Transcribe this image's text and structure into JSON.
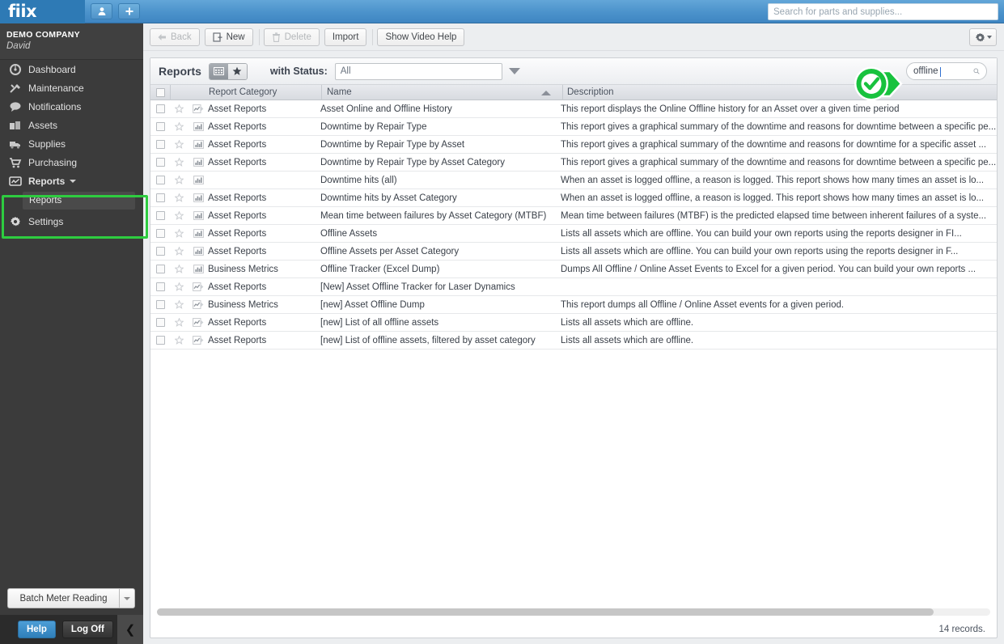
{
  "header": {
    "logo_text": "fiix",
    "buttons": [
      {
        "name": "user-button",
        "icon": "person-icon"
      },
      {
        "name": "add-button",
        "icon": "plus-icon"
      }
    ],
    "search_placeholder": "Search for parts and supplies...",
    "search_value": ""
  },
  "sidebar": {
    "company": "DEMO COMPANY",
    "user": "David",
    "items": [
      {
        "label": "Dashboard",
        "icon": "gauge-icon"
      },
      {
        "label": "Maintenance",
        "icon": "tools-icon"
      },
      {
        "label": "Notifications",
        "icon": "speech-bubble-icon"
      },
      {
        "label": "Assets",
        "icon": "boxes-icon"
      },
      {
        "label": "Supplies",
        "icon": "truck-icon"
      },
      {
        "label": "Purchasing",
        "icon": "cart-icon"
      },
      {
        "label": "Reports",
        "icon": "chart-icon",
        "expanded": true
      },
      {
        "label": "Settings",
        "icon": "gear-icon"
      }
    ],
    "sub_item": "Reports",
    "batch_button": "Batch Meter Reading",
    "help_button": "Help",
    "logoff_button": "Log Off",
    "highlight_color": "#2ecc40"
  },
  "toolbar": {
    "back": "Back",
    "new": "New",
    "delete": "Delete",
    "import": "Import",
    "video_help": "Show Video Help",
    "gear": "gear-icon"
  },
  "panel": {
    "title": "Reports",
    "status_label": "with Status:",
    "status_value": "All",
    "search_value": "offline",
    "records": "14 records."
  },
  "table": {
    "columns": [
      "Report Category",
      "Name",
      "Description"
    ],
    "sort_column": "Name",
    "sort_direction": "asc",
    "rows": [
      {
        "category": "Asset Reports",
        "name": "Asset Online and Offline History",
        "description": "This report displays the Online Offline history for an Asset over a given time period",
        "type_icon": "line-chart-icon"
      },
      {
        "category": "Asset Reports",
        "name": "Downtime by Repair Type",
        "description": "This report gives a graphical summary of the downtime and reasons for downtime between a specific pe...",
        "type_icon": "bar-chart-icon"
      },
      {
        "category": "Asset Reports",
        "name": "Downtime by Repair Type by Asset",
        "description": "This report gives a graphical summary of the downtime and reasons for downtime for a specific asset ...",
        "type_icon": "bar-chart-icon"
      },
      {
        "category": "Asset Reports",
        "name": "Downtime by Repair Type by Asset Category",
        "description": "This report gives a graphical summary of the downtime and reasons for downtime between a specific pe...",
        "type_icon": "bar-chart-icon"
      },
      {
        "category": "",
        "name": "Downtime hits (all)",
        "description": "When an asset is logged offline, a reason is logged. This report shows how many times an asset is lo...",
        "type_icon": "bar-chart-icon"
      },
      {
        "category": "Asset Reports",
        "name": "Downtime hits by Asset Category",
        "description": "When an asset is logged offline, a reason is logged. This report shows how many times an asset is lo...",
        "type_icon": "bar-chart-icon"
      },
      {
        "category": "Asset Reports",
        "name": "Mean time between failures by Asset Category (MTBF)",
        "description": "Mean time between failures (MTBF) is the predicted elapsed time between inherent failures of a syste...",
        "type_icon": "bar-chart-icon"
      },
      {
        "category": "Asset Reports",
        "name": "Offline Assets",
        "description": "Lists all assets which are offline. You can build your own reports using the reports designer in FI...",
        "type_icon": "bar-chart-icon"
      },
      {
        "category": "Asset Reports",
        "name": "Offline Assets per Asset Category",
        "description": "Lists all assets which are offline. You can build your own reports using the reports designer in F...",
        "type_icon": "bar-chart-icon"
      },
      {
        "category": "Business Metrics",
        "name": "Offline Tracker (Excel Dump)",
        "description": "Dumps All Offline / Online Asset Events to Excel for a given period. You can build your own reports ...",
        "type_icon": "bar-chart-icon"
      },
      {
        "category": "Asset Reports",
        "name": "[New] Asset Offline Tracker for Laser Dynamics",
        "description": "",
        "type_icon": "line-chart-icon"
      },
      {
        "category": "Business Metrics",
        "name": "[new] Asset Offline Dump",
        "description": "This report dumps all Offline / Online Asset events for a given period.",
        "type_icon": "line-chart-icon"
      },
      {
        "category": "Asset Reports",
        "name": "[new] List of all offline assets",
        "description": "Lists all assets which are offline.",
        "type_icon": "line-chart-icon"
      },
      {
        "category": "Asset Reports",
        "name": "[new] List of offline assets, filtered by asset category",
        "description": "Lists all assets which are offline.",
        "type_icon": "line-chart-icon"
      }
    ]
  }
}
